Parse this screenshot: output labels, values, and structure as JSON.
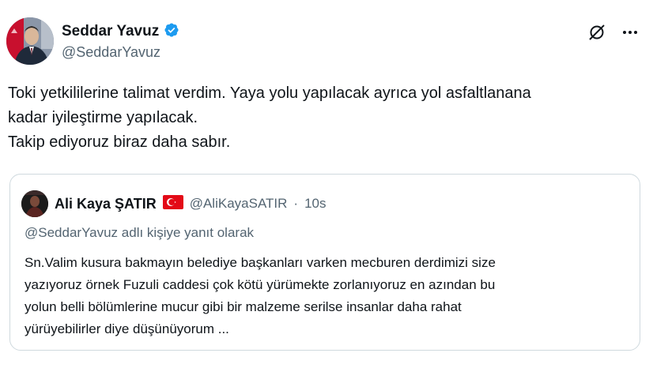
{
  "author": {
    "display_name": "Seddar Yavuz",
    "handle": "@SeddarYavuz",
    "verified": true,
    "verified_color": "#1d9bf0"
  },
  "actions": {
    "grok_icon": "grok-icon",
    "more_icon": "more-icon",
    "more_label": "···"
  },
  "tweet": {
    "lines": [
      "Toki yetkililerine talimat verdim. Yaya yolu yapılacak ayrıca yol asfaltlanana",
      "kadar iyileştirme yapılacak.",
      "Takip ediyoruz biraz daha sabır."
    ]
  },
  "quote": {
    "display_name": "Ali Kaya ŞATIR",
    "flag": "Türkiye",
    "handle": "@AliKayaSATIR",
    "separator": "·",
    "time": "10s",
    "reply_context": "@SeddarYavuz adlı kişiye yanıt olarak",
    "lines": [
      "Sn.Valim kusura bakmayın belediye başkanları varken mecburen derdimizi size",
      "yazıyoruz örnek Fuzuli caddesi çok kötü yürümekte zorlanıyoruz en azından bu",
      "yolun belli bölümlerine mucur gibi bir malzeme serilse insanlar daha rahat",
      "yürüyebilirler diye düşünüyorum ..."
    ]
  },
  "colors": {
    "text": "#0f1419",
    "secondary": "#536471",
    "border": "#cfd9de",
    "flag_red": "#e30a17"
  }
}
